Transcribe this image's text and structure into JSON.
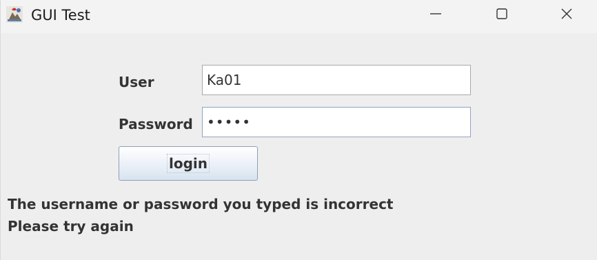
{
  "window": {
    "title": "GUI Test",
    "icon": "java-app-icon",
    "controls": {
      "minimize_icon": "minimize-icon",
      "maximize_icon": "maximize-icon",
      "close_icon": "close-icon"
    }
  },
  "form": {
    "user_label": "User",
    "user_value": "Ka01",
    "password_label": "Password",
    "password_value": "•••••",
    "login_label": "login"
  },
  "message": {
    "line1": "The username or password you typed is incorrect",
    "line2": "Please try again"
  },
  "colors": {
    "background": "#eeeeee",
    "titlebar": "#f3f3f3",
    "text": "#333333"
  }
}
